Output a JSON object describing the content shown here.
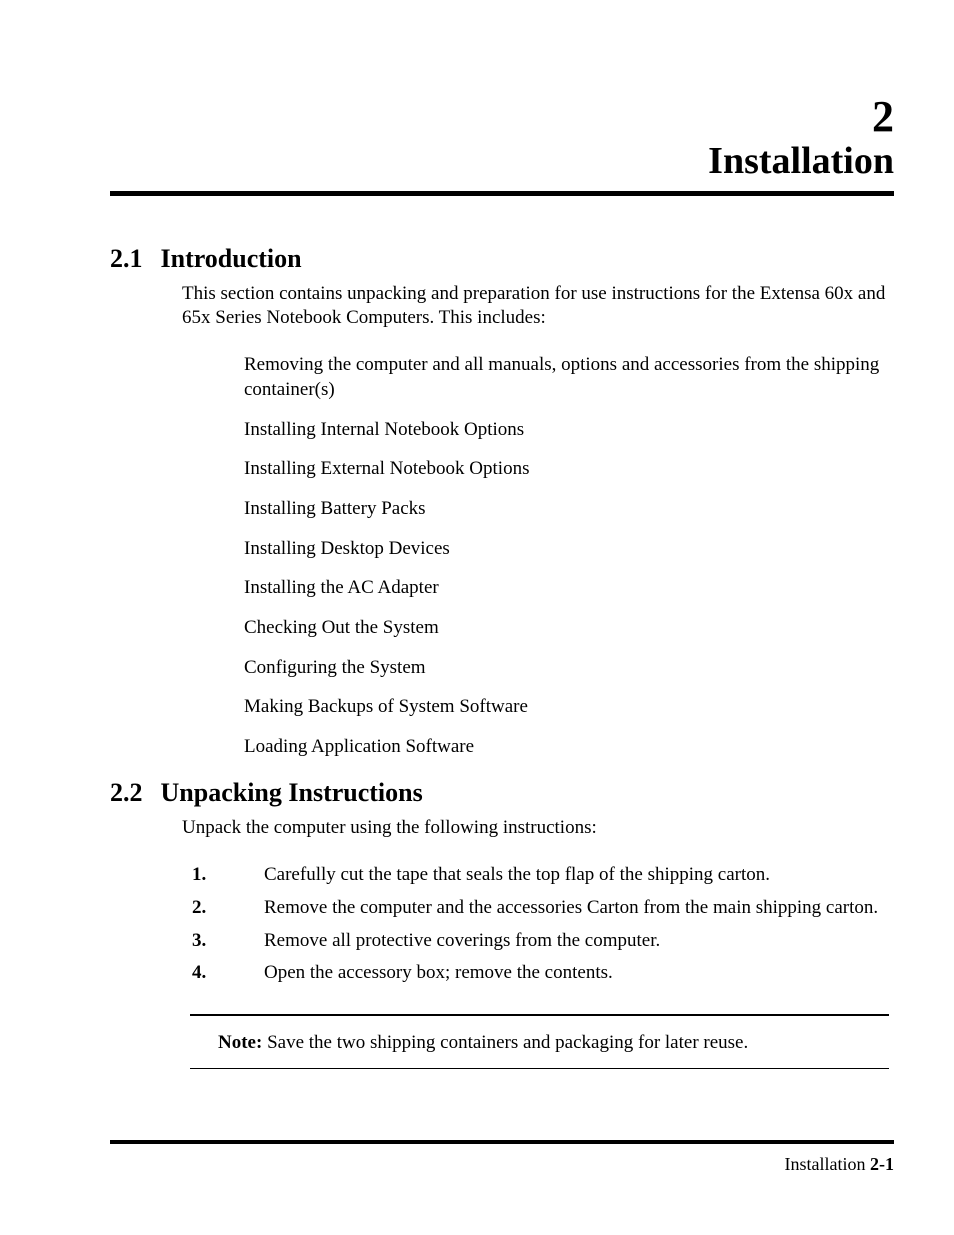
{
  "chapter": {
    "number": "2",
    "title": "Installation"
  },
  "sections": {
    "s1": {
      "number": "2.1",
      "title": "Introduction",
      "intro": "This section contains unpacking and preparation for use instructions for the Extensa 60x and 65x Series Notebook Computers. This includes:",
      "bullets": [
        "Removing the computer and all manuals, options and accessories from the shipping container(s)",
        "Installing Internal Notebook Options",
        "Installing External Notebook Options",
        "Installing Battery Packs",
        "Installing Desktop Devices",
        "Installing the AC Adapter",
        "Checking Out the System",
        "Configuring the System",
        "Making Backups of System Software",
        "Loading Application Software"
      ]
    },
    "s2": {
      "number": "2.2",
      "title": "Unpacking Instructions",
      "intro": "Unpack the computer using the following instructions:",
      "steps": [
        {
          "n": "1.",
          "t": "Carefully cut the tape that seals the top flap of the shipping carton."
        },
        {
          "n": "2.",
          "t": "Remove the computer and the accessories Carton from the main shipping carton."
        },
        {
          "n": "3.",
          "t": "Remove all protective coverings from the computer."
        },
        {
          "n": "4.",
          "t": "Open  the accessory box; remove the contents."
        }
      ]
    }
  },
  "note": {
    "label": "Note:",
    "text": "  Save the two shipping containers and packaging for later reuse."
  },
  "footer": {
    "section": "Installation",
    "page": "2-1"
  }
}
